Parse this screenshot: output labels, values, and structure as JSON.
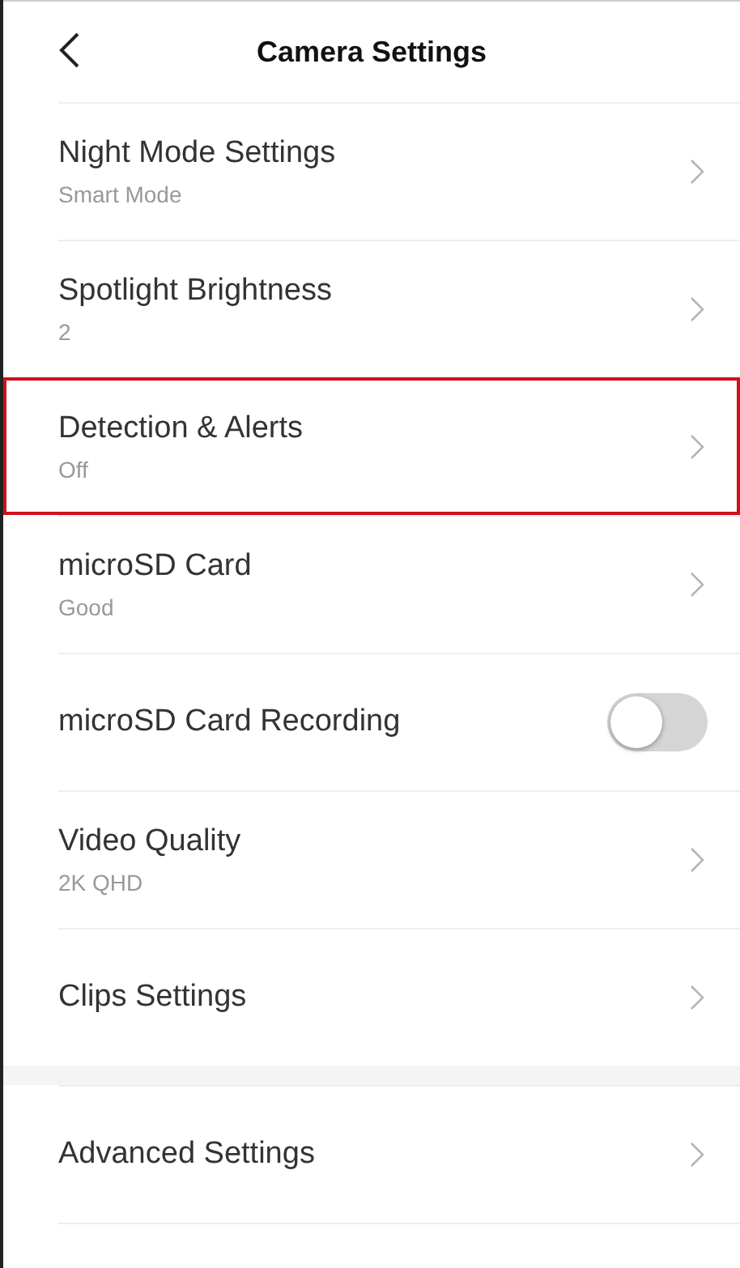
{
  "header": {
    "title": "Camera Settings"
  },
  "sections": [
    {
      "items": [
        {
          "kind": "link",
          "title": "Night Mode Settings",
          "subtitle": "Smart Mode",
          "highlighted": false
        },
        {
          "kind": "link",
          "title": "Spotlight Brightness",
          "subtitle": "2",
          "highlighted": false
        },
        {
          "kind": "link",
          "title": "Detection & Alerts",
          "subtitle": "Off",
          "highlighted": true
        },
        {
          "kind": "link",
          "title": "microSD Card",
          "subtitle": "Good",
          "highlighted": false
        },
        {
          "kind": "toggle",
          "title": "microSD Card Recording",
          "on": false,
          "highlighted": false
        },
        {
          "kind": "link",
          "title": "Video Quality",
          "subtitle": "2K QHD",
          "highlighted": false
        },
        {
          "kind": "link",
          "title": "Clips Settings",
          "highlighted": false
        }
      ]
    },
    {
      "items": [
        {
          "kind": "link",
          "title": "Advanced Settings",
          "highlighted": false
        }
      ]
    }
  ]
}
